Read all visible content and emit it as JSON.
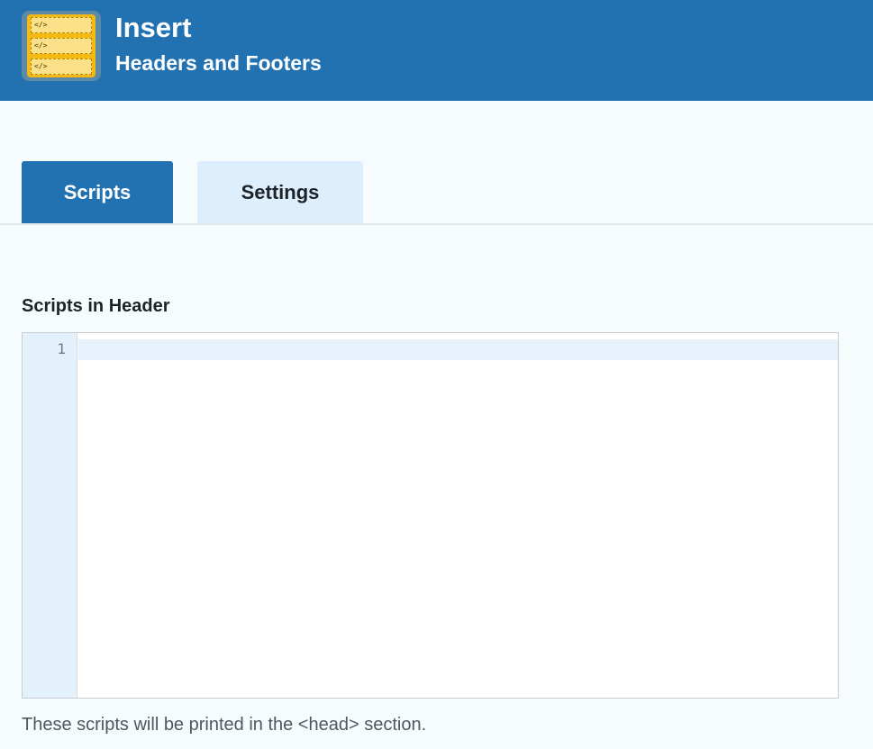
{
  "header": {
    "title": "Insert",
    "subtitle": "Headers and Footers",
    "logo_glyphs": [
      "</>",
      "</>",
      "</>"
    ]
  },
  "tabs": [
    {
      "label": "Scripts",
      "active": true
    },
    {
      "label": "Settings",
      "active": false
    }
  ],
  "section": {
    "label": "Scripts in Header",
    "editor": {
      "line_numbers": [
        "1"
      ],
      "content": ""
    },
    "help_text": "These scripts will be printed in the <head> section."
  },
  "colors": {
    "header_bg": "#2271b1",
    "active_tab_bg": "#2271b1",
    "inactive_tab_bg": "#ddeefc",
    "page_bg": "#f6fbfe",
    "gutter_bg": "#e3f1fd"
  }
}
